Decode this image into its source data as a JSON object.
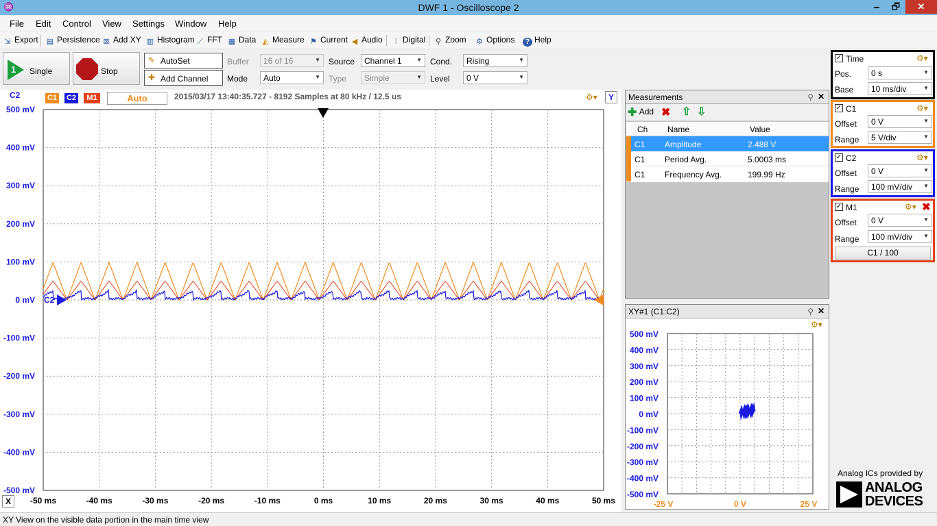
{
  "window": {
    "title": "DWF 1 - Oscilloscope 2",
    "min": "🗕",
    "max": "🗗",
    "close": "✕"
  },
  "menu": [
    "File",
    "Edit",
    "Control",
    "View",
    "Settings",
    "Window",
    "Help"
  ],
  "toolbar": {
    "export": "Export",
    "persistence": "Persistence",
    "addxy": "Add XY",
    "histogram": "Histogram",
    "fft": "FFT",
    "data": "Data",
    "measure": "Measure",
    "current": "Current",
    "audio": "Audio",
    "digital": "Digital",
    "zoom": "Zoom",
    "options": "Options",
    "help": "Help"
  },
  "controls": {
    "single": "Single",
    "stop": "Stop",
    "autoset": "AutoSet",
    "add_channel": "Add Channel",
    "buffer_label": "Buffer",
    "buffer_value": "16 of 16",
    "mode_label": "Mode",
    "mode_value": "Auto",
    "source_label": "Source",
    "source_value": "Channel 1",
    "type_label": "Type",
    "type_value": "Simple",
    "cond_label": "Cond.",
    "cond_value": "Rising",
    "level_label": "Level",
    "level_value": "0 V"
  },
  "plot": {
    "channel_label": "C2",
    "tags": [
      "C1",
      "C2",
      "M1"
    ],
    "auto_label": "Auto",
    "info": "2015/03/17 13:40:35.727 - 8192 Samples at 80 kHz / 12.5 us",
    "y_button": "Y",
    "x_button": "X",
    "marker_label": "C2",
    "y_ticks": [
      "500 mV",
      "400 mV",
      "300 mV",
      "200 mV",
      "100 mV",
      "0 mV",
      "-100 mV",
      "-200 mV",
      "-300 mV",
      "-400 mV",
      "-500 mV"
    ],
    "x_ticks": [
      "-50 ms",
      "-40 ms",
      "-30 ms",
      "-20 ms",
      "-10 ms",
      "0 ms",
      "10 ms",
      "20 ms",
      "30 ms",
      "40 ms",
      "50 ms"
    ]
  },
  "measurements": {
    "title": "Measurements",
    "add": "Add",
    "columns": [
      "Ch",
      "Name",
      "Value"
    ],
    "rows": [
      {
        "ch": "C1",
        "name": "Amplitude",
        "value": "2.488 V"
      },
      {
        "ch": "C1",
        "name": "Period Avg.",
        "value": "5.0003 ms"
      },
      {
        "ch": "C1",
        "name": "Frequency Avg.",
        "value": "199.99 Hz"
      }
    ]
  },
  "xy": {
    "title": "XY#1 (C1:C2)",
    "y_ticks": [
      "500 mV",
      "400 mV",
      "300 mV",
      "200 mV",
      "100 mV",
      "0 mV",
      "-100 mV",
      "-200 mV",
      "-300 mV",
      "-400 mV",
      "-500 mV"
    ],
    "x_ticks": [
      "-25 V",
      "0 V",
      "25 V"
    ]
  },
  "panels": {
    "time": {
      "title": "Time",
      "pos_label": "Pos.",
      "pos_value": "0 s",
      "base_label": "Base",
      "base_value": "10 ms/div"
    },
    "c1": {
      "title": "C1",
      "offset_label": "Offset",
      "offset_value": "0 V",
      "range_label": "Range",
      "range_value": "5 V/div"
    },
    "c2": {
      "title": "C2",
      "offset_label": "Offset",
      "offset_value": "0 V",
      "range_label": "Range",
      "range_value": "100 mV/div"
    },
    "m1": {
      "title": "M1",
      "offset_label": "Offset",
      "offset_value": "0 V",
      "range_label": "Range",
      "range_value": "100 mV/div",
      "formula": "C1 / 100"
    }
  },
  "branding": {
    "text": "Analog ICs provided by",
    "line1": "ANALOG",
    "line2": "DEVICES"
  },
  "status": "XY View on the visible data portion in the main time view",
  "colors": {
    "c1": "#f08c1e",
    "c2": "#1a1ae0",
    "m1": "#e0421a",
    "accent": "#3399ff"
  }
}
